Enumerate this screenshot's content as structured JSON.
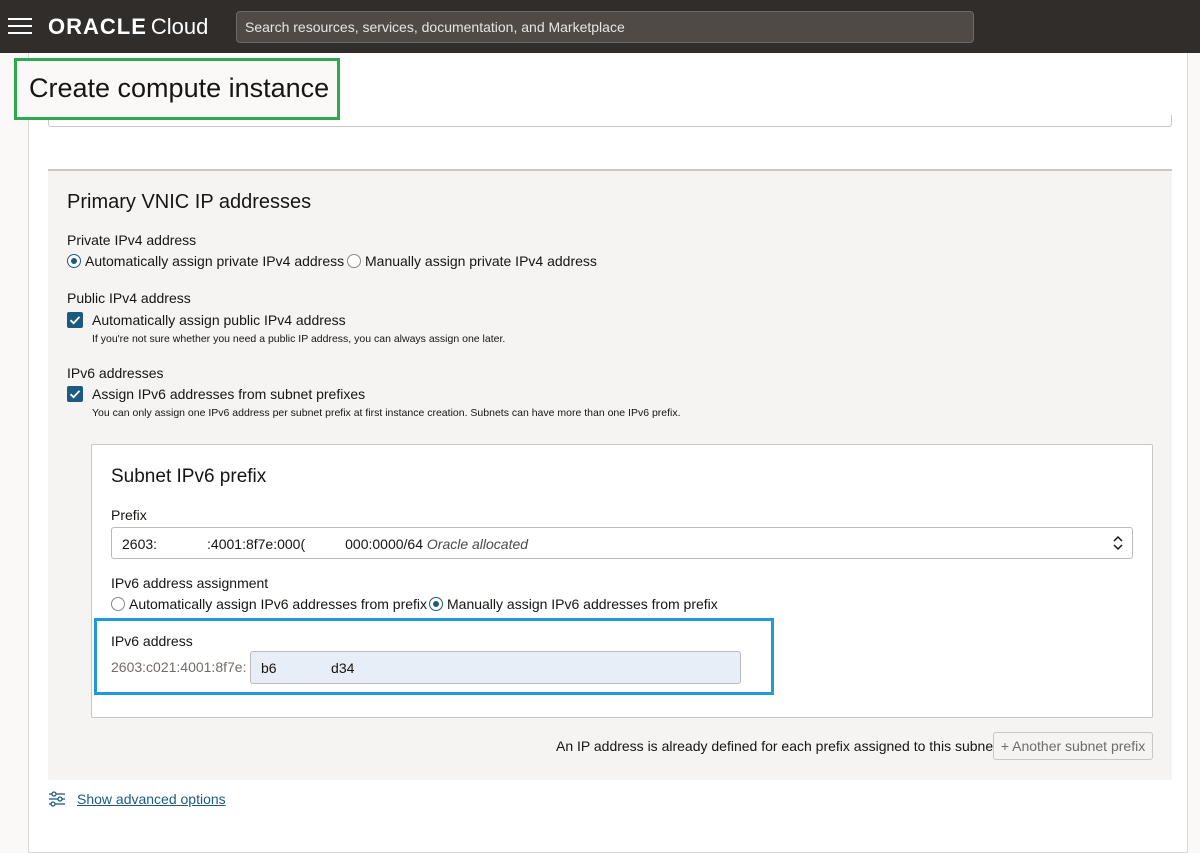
{
  "header": {
    "brand_oracle": "ORACLE",
    "brand_cloud": "Cloud",
    "search_placeholder": "Search resources, services, documentation, and Marketplace"
  },
  "page": {
    "title": "Create compute instance"
  },
  "vnic": {
    "heading": "Primary VNIC IP addresses",
    "private_ipv4": {
      "label": "Private IPv4 address",
      "option_auto": "Automatically assign private IPv4 address",
      "option_manual": "Manually assign private IPv4 address",
      "selected": "auto"
    },
    "public_ipv4": {
      "label": "Public IPv4 address",
      "checkbox_label": "Automatically assign public IPv4 address",
      "checked": true,
      "help": "If you're not sure whether you need a public IP address, you can always assign one later."
    },
    "ipv6": {
      "label": "IPv6 addresses",
      "checkbox_label": "Assign IPv6 addresses from subnet prefixes",
      "checked": true,
      "help": "You can only assign one IPv6 address per subnet prefix at first instance creation. Subnets can have more than one IPv6 prefix."
    }
  },
  "subnet": {
    "heading": "Subnet IPv6 prefix",
    "prefix_label": "Prefix",
    "prefix_part1": "2603:",
    "prefix_part2": ":4001:8f7e:000(",
    "prefix_part3": "000:0000/64",
    "prefix_alloc": "Oracle allocated",
    "assignment_label": "IPv6 address assignment",
    "assign_auto": "Automatically assign IPv6 addresses from prefix",
    "assign_manual": "Manually assign IPv6 addresses from prefix",
    "assign_selected": "manual",
    "address_label": "IPv6 address",
    "address_prefix": "2603:c021:4001:8f7e:",
    "address_value": "b6              d34"
  },
  "footer": {
    "info": "An IP address is already defined for each prefix assigned to this subnet.",
    "another_button": "+ Another subnet prefix",
    "advanced_link": "Show advanced options"
  },
  "colors": {
    "topbar": "#312d2a",
    "accent": "#1d5a80",
    "title_highlight": "#2daa4f",
    "field_highlight": "#1e9bd7"
  }
}
